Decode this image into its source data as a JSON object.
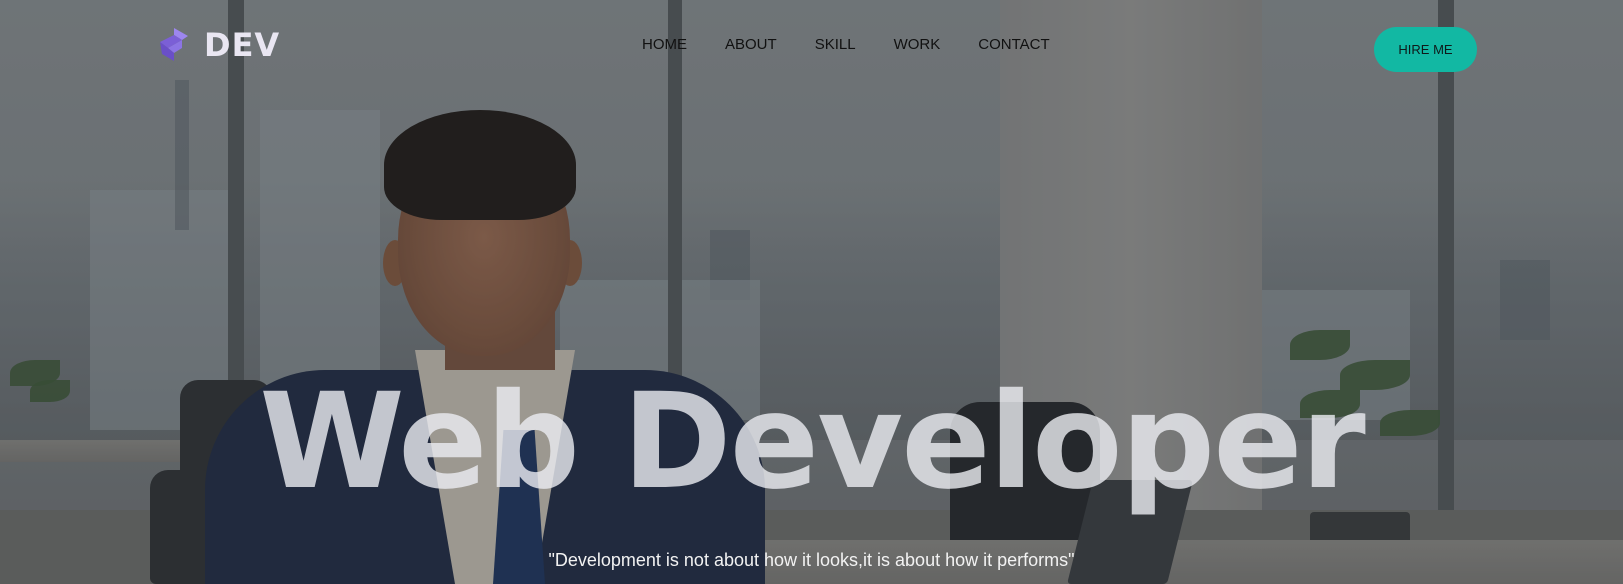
{
  "brand": {
    "name": "DEV",
    "icon": "dev-logo-icon",
    "accent": "#7b5fd6"
  },
  "nav": {
    "items": [
      {
        "label": "HOME"
      },
      {
        "label": "ABOUT"
      },
      {
        "label": "SKILL"
      },
      {
        "label": "WORK"
      },
      {
        "label": "CONTACT"
      }
    ],
    "cta_label": "HIRE ME",
    "cta_color": "#12b8a3"
  },
  "hero": {
    "headline": "Web Developer",
    "tagline": "\"Development is not about how it looks,it is about how it performs\""
  }
}
